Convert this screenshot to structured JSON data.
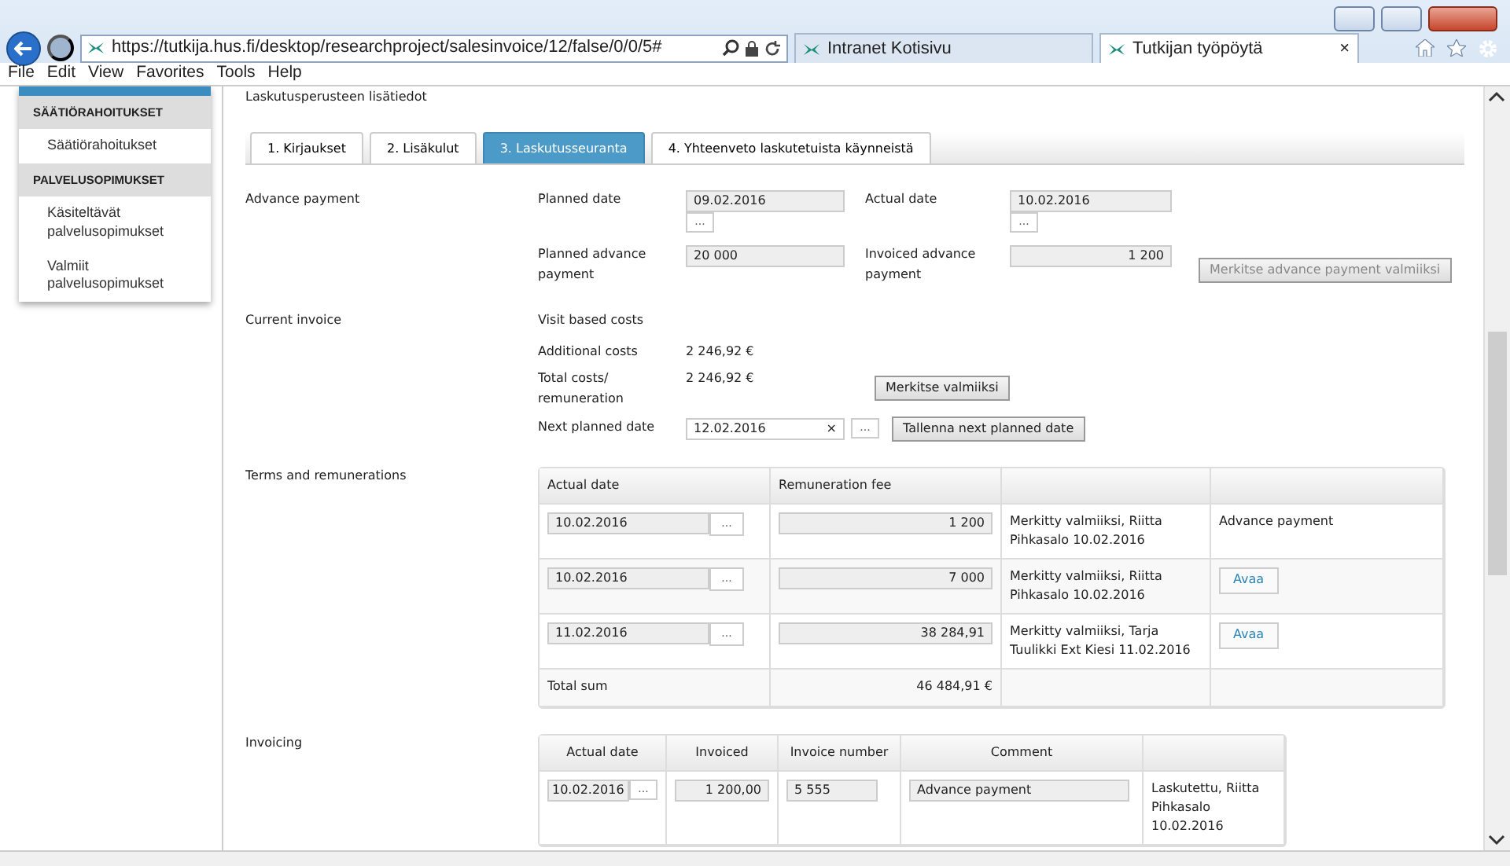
{
  "browser": {
    "url": "https://tutkija.hus.fi/desktop/researchproject/salesinvoice/12/false/0/0/5#",
    "tabs": [
      {
        "label": "Intranet Kotisivu",
        "selected": false
      },
      {
        "label": "Tutkijan työpöytä",
        "selected": true,
        "close": "×"
      }
    ],
    "menu": [
      "File",
      "Edit",
      "View",
      "Favorites",
      "Tools",
      "Help"
    ]
  },
  "sidebar": {
    "sections": [
      {
        "header": "SÄÄTIÖRAHOITUKSET",
        "items": [
          "Säätiörahoitukset"
        ]
      },
      {
        "header": "PALVELUSOPIMUKSET",
        "items": [
          "Käsiteltävät palvelusopimukset",
          "Valmiit palvelusopimukset"
        ]
      }
    ]
  },
  "page_title": "Laskutusperusteen lisätiedot",
  "page_tabs": [
    {
      "label": "1. Kirjaukset",
      "selected": false
    },
    {
      "label": "2. Lisäkulut",
      "selected": false
    },
    {
      "label": "3. Laskutusseuranta",
      "selected": true
    },
    {
      "label": "4. Yhteenveto laskutetuista käynneistä",
      "selected": false
    }
  ],
  "advance_payment": {
    "label": "Advance payment",
    "planned_date": {
      "label": "Planned date",
      "value": "09.02.2016",
      "picker": "..."
    },
    "actual_date": {
      "label": "Actual date",
      "value": "10.02.2016",
      "picker": "..."
    },
    "planned_advance": {
      "label": "Planned advance payment",
      "value": "20 000"
    },
    "invoiced_advance": {
      "label": "Invoiced advance payment",
      "value": "1 200"
    },
    "button": {
      "label": "Merkitse advance payment valmiiksi",
      "disabled": true
    }
  },
  "current_invoice": {
    "label": "Current invoice",
    "visit_costs": {
      "label": "Visit based costs"
    },
    "additional_costs": {
      "label": "Additional costs",
      "value": "2 246,92 €"
    },
    "total_costs": {
      "label": "Total costs/ remuneration",
      "value": "2 246,92 €",
      "button": "Merkitse valmiiksi"
    },
    "next_planned_date": {
      "label": "Next planned date",
      "value": "12.02.2016",
      "clear": "×",
      "picker": "...",
      "button": "Tallenna next planned date"
    }
  },
  "terms": {
    "label": "Terms and remunerations",
    "columns": [
      "Actual date",
      "Remuneration fee"
    ],
    "rows": [
      {
        "date": "10.02.2016",
        "picker": "...",
        "fee": "1 200",
        "status": "Merkitty valmiiksi, Riitta Pihkasalo 10.02.2016",
        "kind": "note",
        "action": "Advance payment"
      },
      {
        "date": "10.02.2016",
        "picker": "...",
        "fee": "7 000",
        "status": "Merkitty valmiiksi, Riitta Pihkasalo 10.02.2016",
        "kind": "button",
        "action": "Avaa"
      },
      {
        "date": "11.02.2016",
        "picker": "...",
        "fee": "38 284,91",
        "status": "Merkitty valmiiksi, Tarja Tuulikki Ext Kiesi 11.02.2016",
        "kind": "button",
        "action": "Avaa"
      }
    ],
    "total": {
      "label": "Total sum",
      "value": "46 484,91 €"
    }
  },
  "invoicing": {
    "label": "Invoicing",
    "columns": [
      "Actual date",
      "Invoiced",
      "Invoice number",
      "Comment"
    ],
    "rows": [
      {
        "date": "10.02.2016",
        "picker": "...",
        "invoiced": "1 200,00",
        "number": "5 555",
        "comment": "Advance payment",
        "status": "Laskutettu, Riitta Pihkasalo 10.02.2016"
      }
    ]
  }
}
